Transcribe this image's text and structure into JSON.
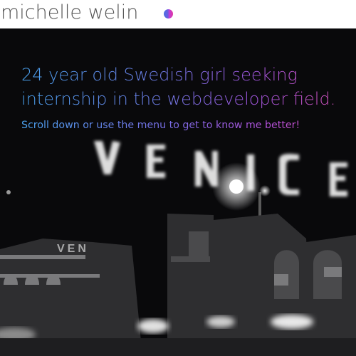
{
  "header": {
    "logo_text": "michelle welin",
    "logo_dot_icon": "gradient-circle-icon"
  },
  "hero": {
    "headline": "24 year old Swedish girl seeking internship in the webdeveloper field.",
    "subline": "Scroll down or use the menu to get to know me better!",
    "background_image": "night-street-venice-sign-photo",
    "gradient_colors": [
      "#4aa3f0",
      "#6c7fe8",
      "#a056e0",
      "#d84fb6"
    ]
  }
}
